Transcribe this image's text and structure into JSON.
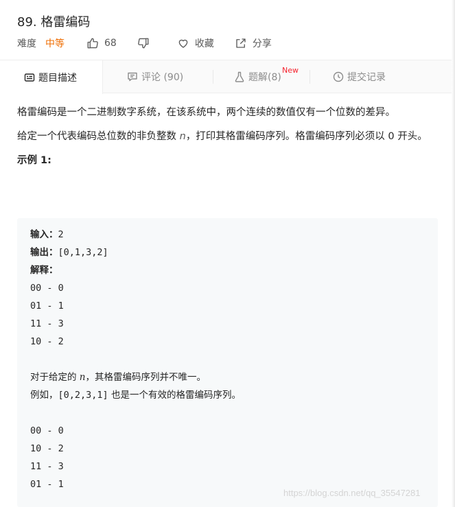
{
  "problem": {
    "title": "89. 格雷编码"
  },
  "meta": {
    "difficulty_label": "难度",
    "difficulty_value": "中等",
    "like_count": "68",
    "favorite_label": "收藏",
    "share_label": "分享",
    "difficulty_color": "#ef6c00",
    "icons": [
      "thumbs-up-icon",
      "thumbs-down-icon",
      "heart-icon",
      "share-icon"
    ]
  },
  "tabs": {
    "description": "题目描述",
    "comments": "评论 (90)",
    "solutions": "题解(8)",
    "solutions_badge": "New",
    "submissions": "提交记录",
    "icons": [
      "description-icon",
      "comment-icon",
      "flask-icon",
      "clock-icon"
    ]
  },
  "description": {
    "p1": "格雷编码是一个二进制数字系统，在该系统中，两个连续的数值仅有一个位数的差异。",
    "p2_before": "给定一个代表编码总位数的非负整数 ",
    "p2_var": "n",
    "p2_after": "，打印其格雷编码序列。格雷编码序列必须以 0 开头。",
    "example_title": "示例 1:"
  },
  "example": {
    "input_label": "输入：",
    "input_value": "2",
    "output_label": "输出：",
    "output_value": "[0,1,3,2]",
    "explain_label": "解释：",
    "seq1": [
      "00 - 0",
      "01 - 1",
      "11 - 3",
      "10 - 2"
    ],
    "note1_before": "对于给定的 ",
    "note1_var": "n",
    "note1_after": "，其格雷编码序列并不唯一。",
    "note2_before": "例如，",
    "note2_code": "[0,2,3,1]",
    "note2_after": " 也是一个有效的格雷编码序列。",
    "seq2": [
      "00 - 0",
      "10 - 2",
      "11 - 3",
      "01 - 1"
    ]
  },
  "watermark": "https://blog.csdn.net/qq_35547281"
}
